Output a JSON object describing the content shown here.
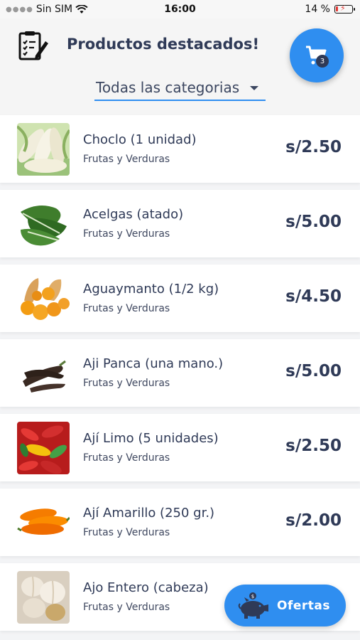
{
  "status_bar": {
    "carrier": "Sin SIM",
    "time": "16:00",
    "battery": "14 %",
    "battery_level": 0.14
  },
  "header": {
    "title": "Productos destacados!",
    "cart_count": "3",
    "category_selected": "Todas las categorias"
  },
  "products": [
    {
      "name": "Choclo (1 unidad)",
      "category": "Frutas y Verduras",
      "price": "s/2.50",
      "image": "corn"
    },
    {
      "name": "Acelgas (atado)",
      "category": "Frutas y Verduras",
      "price": "s/5.00",
      "image": "chard"
    },
    {
      "name": "Aguaymanto (1/2 kg)",
      "category": "Frutas y Verduras",
      "price": "s/4.50",
      "image": "goldenberry"
    },
    {
      "name": "Aji Panca (una mano.)",
      "category": "Frutas y Verduras",
      "price": "s/5.00",
      "image": "dried-pepper"
    },
    {
      "name": "Ají Limo (5 unidades)",
      "category": "Frutas y Verduras",
      "price": "s/2.50",
      "image": "limo-peppers"
    },
    {
      "name": "Ají Amarillo (250 gr.)",
      "category": "Frutas y Verduras",
      "price": "s/2.00",
      "image": "yellow-peppers"
    },
    {
      "name": "Ajo Entero (cabeza)",
      "category": "Frutas y Verduras",
      "price": "",
      "image": "garlic"
    }
  ],
  "offers_button": {
    "label": "Ofertas"
  },
  "colors": {
    "accent": "#2f8ef0",
    "text": "#2f3a57",
    "background": "#f3f4f6"
  }
}
